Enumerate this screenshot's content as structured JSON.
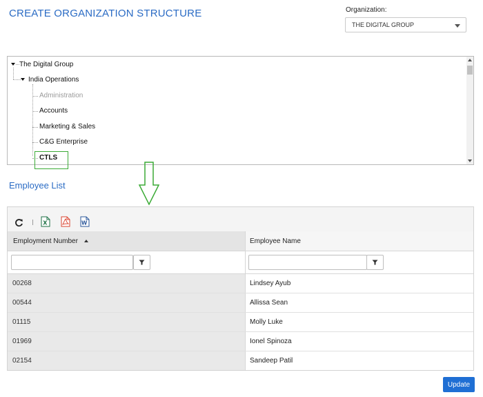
{
  "header": {
    "title": "CREATE ORGANIZATION STRUCTURE"
  },
  "organization": {
    "label": "Organization:",
    "selected": "THE DIGITAL GROUP"
  },
  "tree": {
    "root": "The Digital Group",
    "child": "India Operations",
    "departments": [
      "Administration",
      "Accounts",
      "Marketing & Sales",
      "C&G Enterprise",
      "CTLS"
    ]
  },
  "employee_list": {
    "title": "Employee List",
    "toolbar": {
      "refresh": "refresh-icon",
      "excel": "excel-export-icon",
      "pdf": "pdf-export-icon",
      "word": "word-export-icon"
    },
    "columns": [
      "Employment Number",
      "Employee Name"
    ],
    "rows": [
      {
        "number": "00268",
        "name": "Lindsey Ayub"
      },
      {
        "number": "00544",
        "name": "Allissa Sean"
      },
      {
        "number": "01115",
        "name": "Molly Luke"
      },
      {
        "number": "01969",
        "name": "Ionel Spinoza"
      },
      {
        "number": "02154",
        "name": "Sandeep Patil"
      }
    ]
  },
  "actions": {
    "update": "Update"
  },
  "colors": {
    "accent": "#2a6bc4",
    "highlight": "#3aaa35",
    "button": "#1f6fd4"
  }
}
